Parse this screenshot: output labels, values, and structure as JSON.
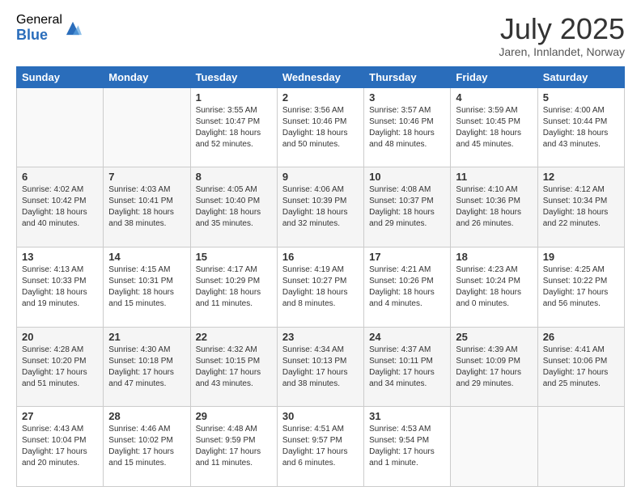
{
  "logo": {
    "general": "General",
    "blue": "Blue"
  },
  "title": "July 2025",
  "location": "Jaren, Innlandet, Norway",
  "days_of_week": [
    "Sunday",
    "Monday",
    "Tuesday",
    "Wednesday",
    "Thursday",
    "Friday",
    "Saturday"
  ],
  "weeks": [
    [
      {
        "day": "",
        "info": ""
      },
      {
        "day": "",
        "info": ""
      },
      {
        "day": "1",
        "info": "Sunrise: 3:55 AM\nSunset: 10:47 PM\nDaylight: 18 hours and 52 minutes."
      },
      {
        "day": "2",
        "info": "Sunrise: 3:56 AM\nSunset: 10:46 PM\nDaylight: 18 hours and 50 minutes."
      },
      {
        "day": "3",
        "info": "Sunrise: 3:57 AM\nSunset: 10:46 PM\nDaylight: 18 hours and 48 minutes."
      },
      {
        "day": "4",
        "info": "Sunrise: 3:59 AM\nSunset: 10:45 PM\nDaylight: 18 hours and 45 minutes."
      },
      {
        "day": "5",
        "info": "Sunrise: 4:00 AM\nSunset: 10:44 PM\nDaylight: 18 hours and 43 minutes."
      }
    ],
    [
      {
        "day": "6",
        "info": "Sunrise: 4:02 AM\nSunset: 10:42 PM\nDaylight: 18 hours and 40 minutes."
      },
      {
        "day": "7",
        "info": "Sunrise: 4:03 AM\nSunset: 10:41 PM\nDaylight: 18 hours and 38 minutes."
      },
      {
        "day": "8",
        "info": "Sunrise: 4:05 AM\nSunset: 10:40 PM\nDaylight: 18 hours and 35 minutes."
      },
      {
        "day": "9",
        "info": "Sunrise: 4:06 AM\nSunset: 10:39 PM\nDaylight: 18 hours and 32 minutes."
      },
      {
        "day": "10",
        "info": "Sunrise: 4:08 AM\nSunset: 10:37 PM\nDaylight: 18 hours and 29 minutes."
      },
      {
        "day": "11",
        "info": "Sunrise: 4:10 AM\nSunset: 10:36 PM\nDaylight: 18 hours and 26 minutes."
      },
      {
        "day": "12",
        "info": "Sunrise: 4:12 AM\nSunset: 10:34 PM\nDaylight: 18 hours and 22 minutes."
      }
    ],
    [
      {
        "day": "13",
        "info": "Sunrise: 4:13 AM\nSunset: 10:33 PM\nDaylight: 18 hours and 19 minutes."
      },
      {
        "day": "14",
        "info": "Sunrise: 4:15 AM\nSunset: 10:31 PM\nDaylight: 18 hours and 15 minutes."
      },
      {
        "day": "15",
        "info": "Sunrise: 4:17 AM\nSunset: 10:29 PM\nDaylight: 18 hours and 11 minutes."
      },
      {
        "day": "16",
        "info": "Sunrise: 4:19 AM\nSunset: 10:27 PM\nDaylight: 18 hours and 8 minutes."
      },
      {
        "day": "17",
        "info": "Sunrise: 4:21 AM\nSunset: 10:26 PM\nDaylight: 18 hours and 4 minutes."
      },
      {
        "day": "18",
        "info": "Sunrise: 4:23 AM\nSunset: 10:24 PM\nDaylight: 18 hours and 0 minutes."
      },
      {
        "day": "19",
        "info": "Sunrise: 4:25 AM\nSunset: 10:22 PM\nDaylight: 17 hours and 56 minutes."
      }
    ],
    [
      {
        "day": "20",
        "info": "Sunrise: 4:28 AM\nSunset: 10:20 PM\nDaylight: 17 hours and 51 minutes."
      },
      {
        "day": "21",
        "info": "Sunrise: 4:30 AM\nSunset: 10:18 PM\nDaylight: 17 hours and 47 minutes."
      },
      {
        "day": "22",
        "info": "Sunrise: 4:32 AM\nSunset: 10:15 PM\nDaylight: 17 hours and 43 minutes."
      },
      {
        "day": "23",
        "info": "Sunrise: 4:34 AM\nSunset: 10:13 PM\nDaylight: 17 hours and 38 minutes."
      },
      {
        "day": "24",
        "info": "Sunrise: 4:37 AM\nSunset: 10:11 PM\nDaylight: 17 hours and 34 minutes."
      },
      {
        "day": "25",
        "info": "Sunrise: 4:39 AM\nSunset: 10:09 PM\nDaylight: 17 hours and 29 minutes."
      },
      {
        "day": "26",
        "info": "Sunrise: 4:41 AM\nSunset: 10:06 PM\nDaylight: 17 hours and 25 minutes."
      }
    ],
    [
      {
        "day": "27",
        "info": "Sunrise: 4:43 AM\nSunset: 10:04 PM\nDaylight: 17 hours and 20 minutes."
      },
      {
        "day": "28",
        "info": "Sunrise: 4:46 AM\nSunset: 10:02 PM\nDaylight: 17 hours and 15 minutes."
      },
      {
        "day": "29",
        "info": "Sunrise: 4:48 AM\nSunset: 9:59 PM\nDaylight: 17 hours and 11 minutes."
      },
      {
        "day": "30",
        "info": "Sunrise: 4:51 AM\nSunset: 9:57 PM\nDaylight: 17 hours and 6 minutes."
      },
      {
        "day": "31",
        "info": "Sunrise: 4:53 AM\nSunset: 9:54 PM\nDaylight: 17 hours and 1 minute."
      },
      {
        "day": "",
        "info": ""
      },
      {
        "day": "",
        "info": ""
      }
    ]
  ]
}
